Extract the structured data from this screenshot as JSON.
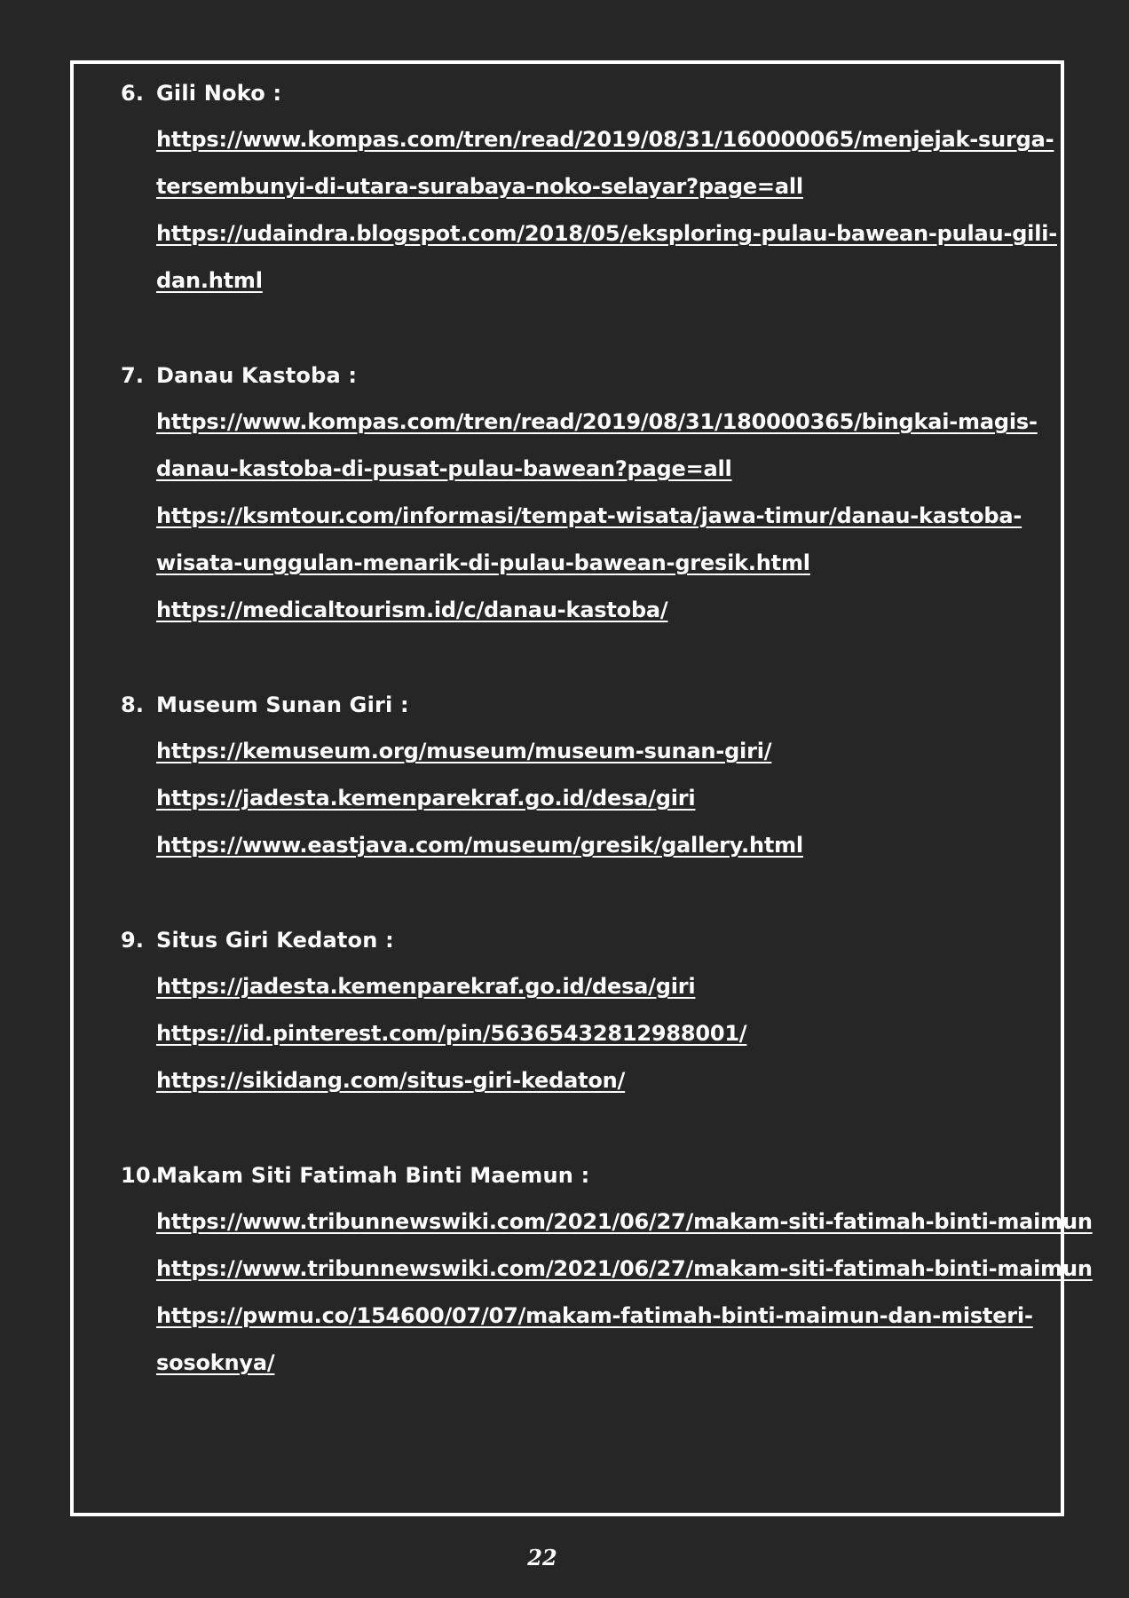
{
  "entries": [
    {
      "number": "6.",
      "title": "Gili Noko :",
      "links": [
        [
          "https://www.kompas.com/tren/read/2019/08/31/160000065/menjejak-surga-",
          "tersembunyi-di-utara-surabaya-noko-selayar?page=all"
        ],
        [
          "https://udaindra.blogspot.com/2018/05/eksploring-pulau-bawean-pulau-gili-",
          "dan.html"
        ]
      ]
    },
    {
      "number": "7.",
      "title": "Danau Kastoba :",
      "links": [
        [
          "https://www.kompas.com/tren/read/2019/08/31/180000365/bingkai-magis-",
          "danau-kastoba-di-pusat-pulau-bawean?page=all"
        ],
        [
          "https://ksmtour.com/informasi/tempat-wisata/jawa-timur/danau-kastoba-",
          "wisata-unggulan-menarik-di-pulau-bawean-gresik.html"
        ],
        [
          "https://medicaltourism.id/c/danau-kastoba/"
        ]
      ]
    },
    {
      "number": "8.",
      "title": "Museum Sunan Giri :",
      "links": [
        [
          "https://kemuseum.org/museum/museum-sunan-giri/"
        ],
        [
          "https://jadesta.kemenparekraf.go.id/desa/giri"
        ],
        [
          "https://www.eastjava.com/museum/gresik/gallery.html"
        ]
      ]
    },
    {
      "number": "9.",
      "title": "Situs Giri Kedaton :",
      "links": [
        [
          "https://jadesta.kemenparekraf.go.id/desa/giri"
        ],
        [
          "https://id.pinterest.com/pin/563654328129880​01/"
        ],
        [
          "https://sikidang.com/situs-giri-kedaton/"
        ]
      ]
    },
    {
      "number": "10.",
      "title": "Makam Siti Fatimah Binti Maemun :",
      "links": [
        [
          "https://www.tribunnewswiki.com/2021/06/27/makam-siti-fatimah-binti-maimun"
        ],
        [
          "https://www.tribunnewswiki.com/2021/06/27/makam-siti-fatimah-binti-maimun"
        ],
        [
          "https://pwmu.co/154600/07/07/makam-fatimah-binti-maimun-dan-misteri-",
          "sosoknya/"
        ]
      ]
    }
  ],
  "page_number": "22"
}
